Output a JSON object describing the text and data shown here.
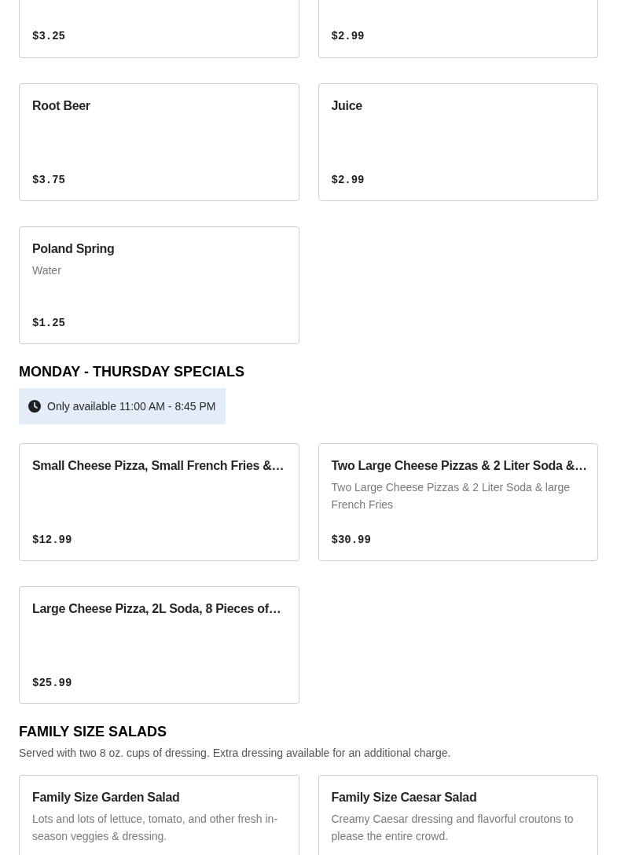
{
  "sections": [
    {
      "items": [
        {
          "price": "$3.25"
        },
        {
          "price": "$2.99"
        },
        {
          "name": "Root Beer",
          "price": "$3.75"
        },
        {
          "name": "Juice",
          "price": "$2.99"
        },
        {
          "name": "Poland Spring",
          "description": "Water",
          "price": "$1.25"
        }
      ]
    },
    {
      "heading": "MONDAY - THURSDAY SPECIALS",
      "notice": "Only available 11:00 AM - 8:45 PM",
      "items": [
        {
          "name": "Small Cheese Pizza, Small French Fries &…",
          "price": "$12.99"
        },
        {
          "name": "Two Large Cheese Pizzas & 2 Liter Soda &…",
          "description": "Two Large Cheese Pizzas & 2 Liter Soda & large French Fries",
          "price": "$30.99"
        },
        {
          "name": "Large Cheese Pizza, 2L Soda, 8 Pieces of…",
          "price": "$25.99"
        }
      ]
    },
    {
      "heading": "FAMILY SIZE SALADS",
      "description": "Served with two 8 oz. cups of dressing. Extra dressing available for an additional charge.",
      "items": [
        {
          "name": "Family Size Garden Salad",
          "description": "Lots and lots of lettuce, tomato, and other fresh in-season veggies & dressing."
        },
        {
          "name": "Family Size Caesar Salad",
          "description": "Creamy Caesar dressing and flavorful croutons to please the entire crowd."
        }
      ]
    }
  ]
}
